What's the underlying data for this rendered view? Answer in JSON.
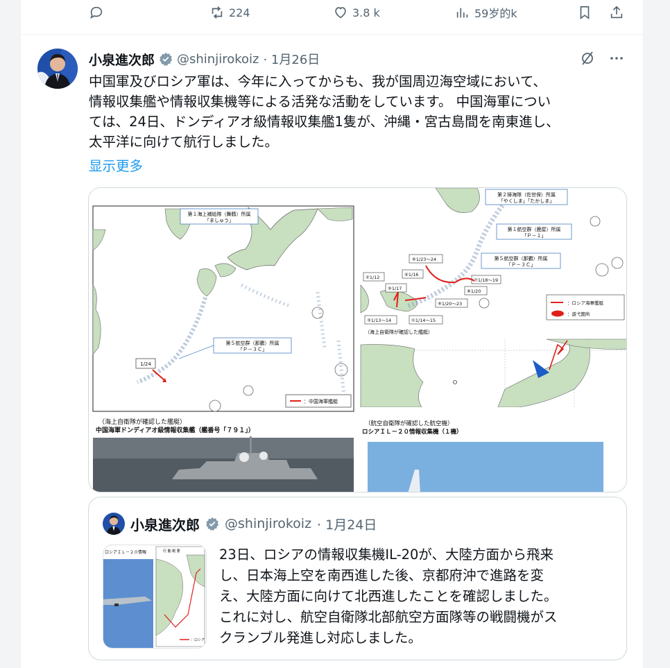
{
  "actions": {
    "retweets": "224",
    "likes": "3.8 k",
    "views": "59岁的k"
  },
  "tweet": {
    "author_name": "小泉進次郎",
    "handle": "@shinjirokoiz",
    "date": "· 1月26日",
    "text_lines": [
      "中国軍及びロシア軍は、今年に入ってからも、我が国周辺海空域において、",
      "情報収集艦や情報収集機等による活発な活動をしています。 中国海軍につい",
      "ては、24日、ドンディアオ級情報収集艦1隻が、沖縄・宮古島間を南東進し、",
      "太平洋に向けて航行しました。"
    ],
    "show_more": "显示更多"
  },
  "media": {
    "left_map": {
      "box1": [
        "第１海上補給隊（舞鶴）所属",
        "「ましゅう」"
      ],
      "box2": [
        "第５航空群（那覇）所属",
        "「Ｐ－３Ｃ」"
      ],
      "date_label": "1/24",
      "legend": "：中国海軍艦艇",
      "caption_line1": "（海上自衛隊が確認した艦艇）",
      "caption_line2": "中国海軍ドンディアオ級情報収集艦（艦番号「７９１」）"
    },
    "right_map": {
      "box1": [
        "第２掃海隊（佐世保）所属",
        "「やくしま」「たかしま」"
      ],
      "box2": [
        "第１航空群（鹿屋）所属",
        "「Ｐ－１」"
      ],
      "box3": [
        "第５航空群（那覇）所属",
        "「Ｐ－３Ｃ」"
      ],
      "dates": [
        "⑥1/23～24",
        "②1/12",
        "④1/16",
        "⑦1/18～19",
        "⑤1/17",
        "⑧1/20",
        "⑨1/20～23",
        "③1/13～14",
        "①1/14～15"
      ],
      "legend1": "：ロシア海軍艦艇",
      "legend2": "：遊弋箇所",
      "caption_small": "（海上自衛隊が確認した艦艇）",
      "caption_line1": "（航空自衛隊が確認した航空機）",
      "caption_line2": "ロシアＩＬ－２０情報収集機（１機）"
    }
  },
  "quote": {
    "author_name": "小泉進次郎",
    "handle": "@shinjirokoiz",
    "date": "· 1月24日",
    "thumb_label": "ロシアＩＬ－２０情報",
    "thumb_title": "行 動 概 要",
    "thumb_legend": "：ロシア",
    "text_lines": [
      "23日、ロシアの情報収集機IL-20が、大陸方面から飛来",
      "し、日本海上空を南西進した後、京都府沖で進路を変",
      "え、大陸方面に向けて北西進したことを確認しました。",
      "これに対し、航空自衛隊北部航空方面隊等の戦闘機がス",
      "クランブル発進し対応しました。"
    ]
  },
  "colors": {
    "accent": "#1d9bf0",
    "secondary_text": "#536471",
    "border": "#cfd9de",
    "map_red": "#e0201a",
    "map_blue": "#1b5cc7"
  }
}
